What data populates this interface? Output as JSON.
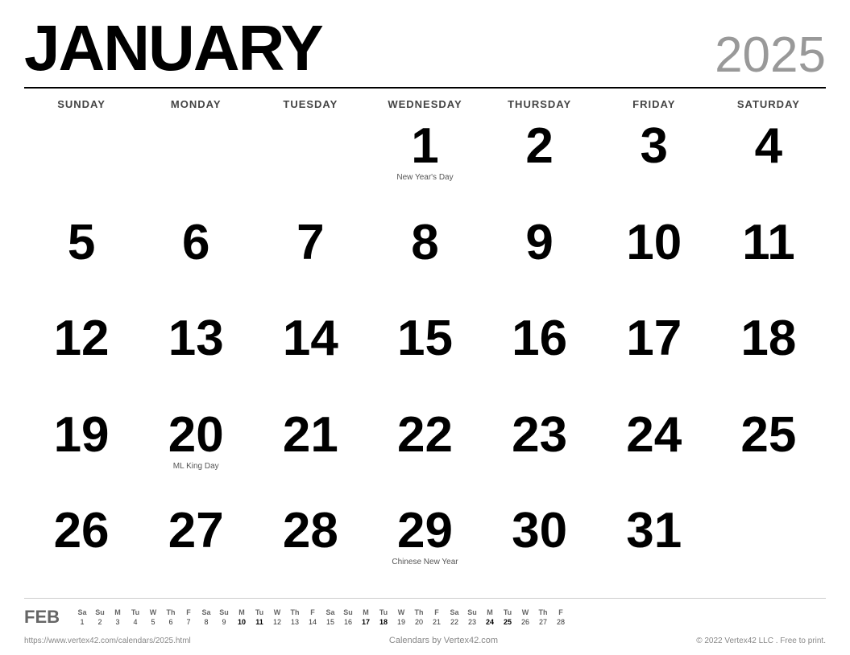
{
  "header": {
    "month": "JANUARY",
    "year": "2025"
  },
  "day_headers": [
    "SUNDAY",
    "MONDAY",
    "TUESDAY",
    "WEDNESDAY",
    "THURSDAY",
    "FRIDAY",
    "SATURDAY"
  ],
  "weeks": [
    [
      {
        "date": "",
        "holiday": ""
      },
      {
        "date": "",
        "holiday": ""
      },
      {
        "date": "",
        "holiday": ""
      },
      {
        "date": "1",
        "holiday": "New Year's Day"
      },
      {
        "date": "2",
        "holiday": ""
      },
      {
        "date": "3",
        "holiday": ""
      },
      {
        "date": "4",
        "holiday": ""
      }
    ],
    [
      {
        "date": "5",
        "holiday": ""
      },
      {
        "date": "6",
        "holiday": ""
      },
      {
        "date": "7",
        "holiday": ""
      },
      {
        "date": "8",
        "holiday": ""
      },
      {
        "date": "9",
        "holiday": ""
      },
      {
        "date": "10",
        "holiday": ""
      },
      {
        "date": "11",
        "holiday": ""
      }
    ],
    [
      {
        "date": "12",
        "holiday": ""
      },
      {
        "date": "13",
        "holiday": ""
      },
      {
        "date": "14",
        "holiday": ""
      },
      {
        "date": "15",
        "holiday": ""
      },
      {
        "date": "16",
        "holiday": ""
      },
      {
        "date": "17",
        "holiday": ""
      },
      {
        "date": "18",
        "holiday": ""
      }
    ],
    [
      {
        "date": "19",
        "holiday": ""
      },
      {
        "date": "20",
        "holiday": "ML King Day"
      },
      {
        "date": "21",
        "holiday": ""
      },
      {
        "date": "22",
        "holiday": ""
      },
      {
        "date": "23",
        "holiday": ""
      },
      {
        "date": "24",
        "holiday": ""
      },
      {
        "date": "25",
        "holiday": ""
      }
    ],
    [
      {
        "date": "26",
        "holiday": ""
      },
      {
        "date": "27",
        "holiday": ""
      },
      {
        "date": "28",
        "holiday": ""
      },
      {
        "date": "29",
        "holiday": "Chinese New Year"
      },
      {
        "date": "30",
        "holiday": ""
      },
      {
        "date": "31",
        "holiday": ""
      },
      {
        "date": "",
        "holiday": ""
      }
    ]
  ],
  "mini_calendar": {
    "month_label": "FEB",
    "day_headers": [
      "Sa",
      "Su",
      "M",
      "Tu",
      "W",
      "Th",
      "F",
      "Sa",
      "Su",
      "M",
      "Tu",
      "W",
      "Th",
      "F",
      "Sa",
      "Su",
      "M",
      "Tu",
      "W",
      "Th",
      "F",
      "Sa",
      "Su",
      "M",
      "Tu",
      "W",
      "Th",
      "F"
    ],
    "days": [
      "1",
      "2",
      "3",
      "4",
      "5",
      "6",
      "7",
      "8",
      "9",
      "10",
      "11",
      "12",
      "13",
      "14",
      "15",
      "16",
      "17",
      "18",
      "19",
      "20",
      "21",
      "22",
      "23",
      "24",
      "25",
      "26",
      "27",
      "28"
    ],
    "bold_days": [
      "10",
      "11",
      "17",
      "18",
      "24",
      "25"
    ]
  },
  "footer": {
    "url": "https://www.vertex42.com/calendars/2025.html",
    "center": "Calendars by Vertex42.com",
    "copyright": "© 2022 Vertex42 LLC . Free to print."
  }
}
